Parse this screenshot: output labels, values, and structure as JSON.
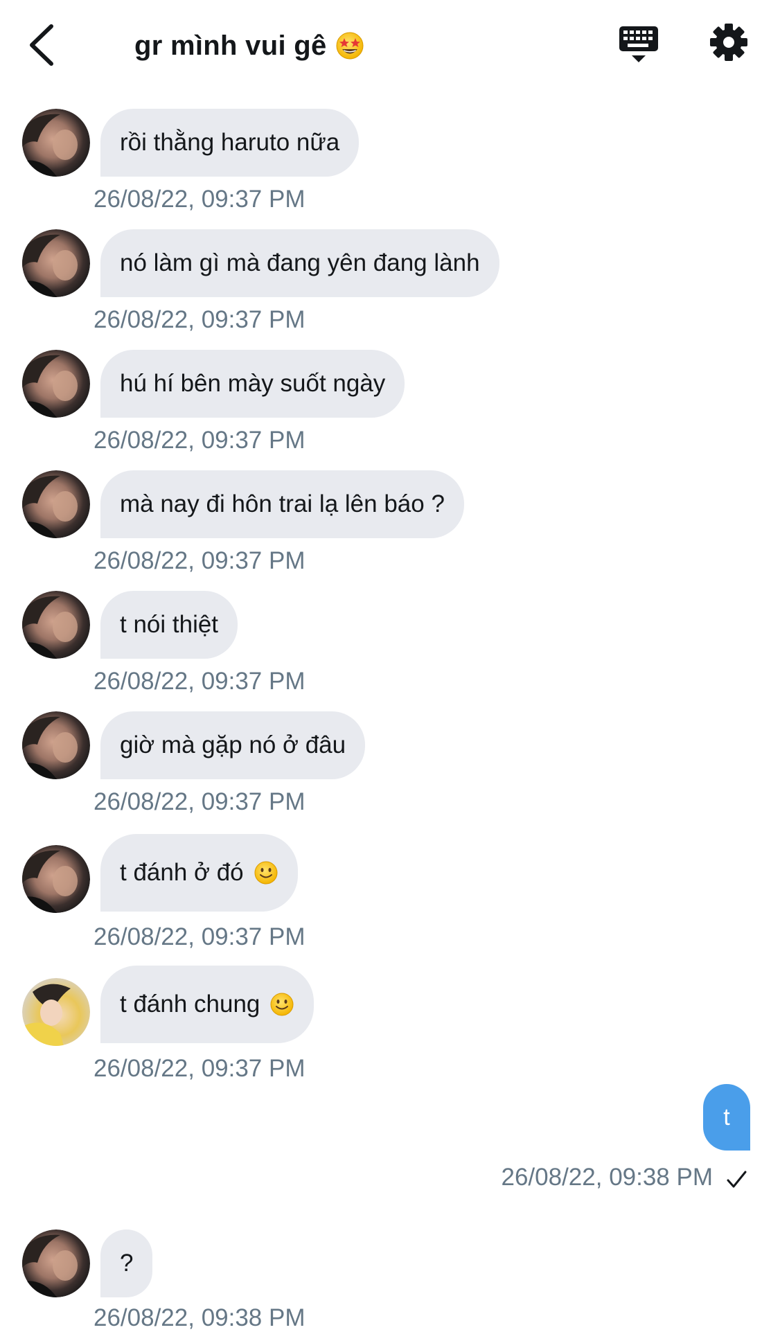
{
  "header": {
    "title": "gr mình vui gê",
    "title_emoji": "star-struck-emoji",
    "icons": {
      "back": "back-arrow-icon",
      "keyboard": "keyboard-icon",
      "settings": "gear-icon"
    }
  },
  "messages": [
    {
      "text": "rồi thằng haruto nữa",
      "time": "26/08/22, 09:37 PM",
      "avatar": "avatar-dark-hair"
    },
    {
      "text": "nó làm gì mà đang yên đang lành",
      "time": "26/08/22, 09:37 PM",
      "avatar": "avatar-dark-hair"
    },
    {
      "text": "hú hí bên mày suốt ngày",
      "time": "26/08/22, 09:37 PM",
      "avatar": "avatar-dark-hair"
    },
    {
      "text": "mà nay đi hôn trai lạ lên báo ?",
      "time": "26/08/22, 09:37 PM",
      "avatar": "avatar-dark-hair"
    },
    {
      "text": "t nói thiệt",
      "time": "26/08/22, 09:37 PM",
      "avatar": "avatar-dark-hair"
    },
    {
      "text": "giờ mà gặp nó ở đâu",
      "time": "26/08/22, 09:37 PM",
      "avatar": "avatar-dark-hair"
    },
    {
      "text": "t đánh ở đó",
      "emoji": "slightly-smiling-face",
      "time": "26/08/22, 09:37 PM",
      "avatar": "avatar-dark-hair"
    },
    {
      "text": "t đánh chung",
      "emoji": "slightly-smiling-face",
      "time": "26/08/22, 09:37 PM",
      "avatar": "avatar-yellow-hood"
    }
  ],
  "outgoing": {
    "text": "t",
    "time": "26/08/22, 09:38 PM",
    "status": "sent-check-icon"
  },
  "last_message": {
    "text": "?",
    "time": "26/08/22, 09:38 PM",
    "avatar": "avatar-dark-hair"
  },
  "colors": {
    "incoming_bubble": "#e8eaef",
    "outgoing_bubble": "#4a9eea",
    "timestamp": "#657786",
    "text": "#14171a"
  }
}
